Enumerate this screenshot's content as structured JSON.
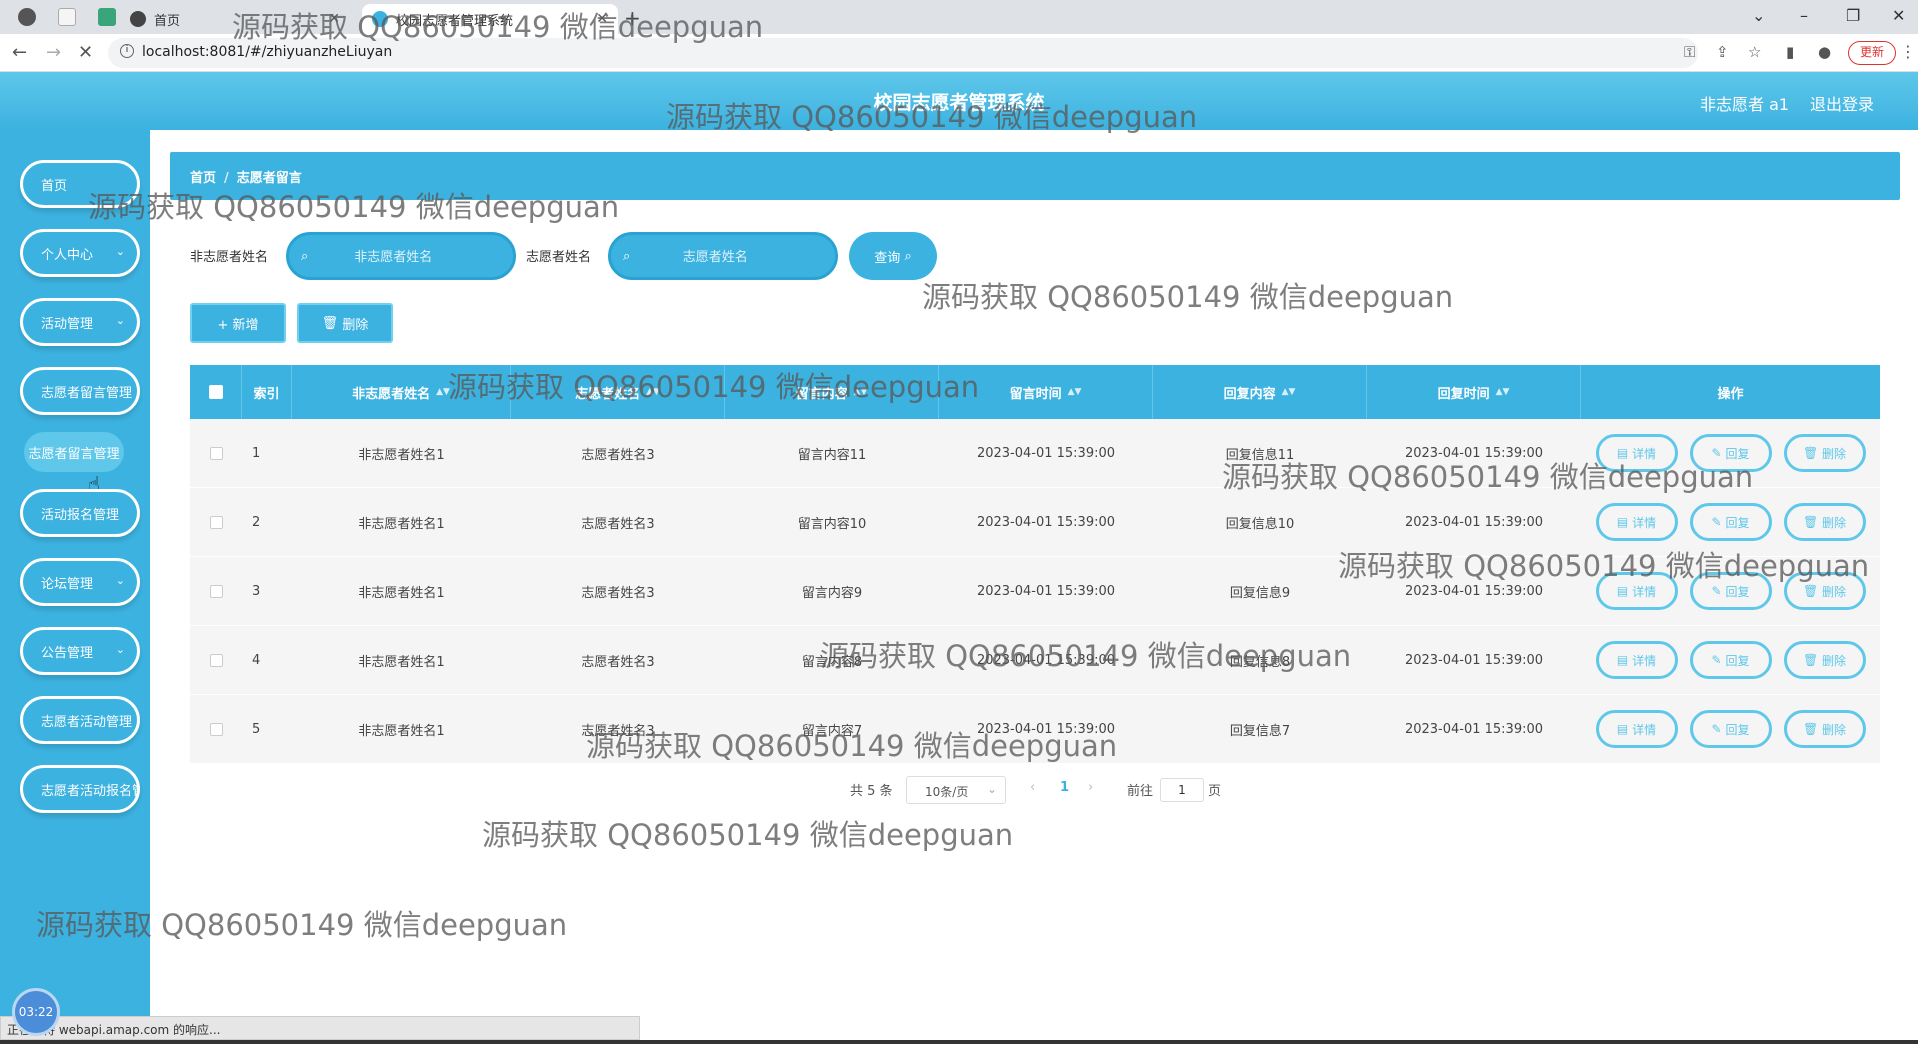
{
  "browser": {
    "tabs": [
      {
        "label": "首页"
      },
      {
        "label": "校园志愿者管理系统"
      }
    ],
    "url": "localhost:8081/#/zhiyuanzheLiuyan",
    "update_label": "更新",
    "status_text": "正在等待 webapi.amap.com 的响应..."
  },
  "header": {
    "title": "校园志愿者管理系统",
    "user": "非志愿者 a1",
    "logout": "退出登录"
  },
  "sidebar": {
    "items": [
      {
        "label": "首页"
      },
      {
        "label": "个人中心"
      },
      {
        "label": "活动管理"
      },
      {
        "label": "志愿者留言管理"
      },
      {
        "label": "活动报名管理"
      },
      {
        "label": "论坛管理"
      },
      {
        "label": "公告管理"
      },
      {
        "label": "志愿者活动管理"
      },
      {
        "label": "志愿者活动报名管理"
      }
    ],
    "active_sub": "志愿者留言管理"
  },
  "breadcrumb": {
    "home": "首页",
    "sep": "/",
    "current": "志愿者留言"
  },
  "filters": {
    "f1_label": "非志愿者姓名",
    "f1_placeholder": "非志愿者姓名",
    "f2_label": "志愿者姓名",
    "f2_placeholder": "志愿者姓名",
    "query_label": "查询"
  },
  "actions": {
    "add": "+ 新增",
    "delete": "删除"
  },
  "table": {
    "headers": [
      "索引",
      "非志愿者姓名",
      "志愿者姓名",
      "留言内容",
      "留言时间",
      "回复内容",
      "回复时间",
      "操作"
    ],
    "rows": [
      {
        "idx": "1",
        "c1": "非志愿者姓名1",
        "c2": "志愿者姓名3",
        "c3": "留言内容11",
        "c4": "2023-04-01 15:39:00",
        "c5": "回复信息11",
        "c6": "2023-04-01 15:39:00"
      },
      {
        "idx": "2",
        "c1": "非志愿者姓名1",
        "c2": "志愿者姓名3",
        "c3": "留言内容10",
        "c4": "2023-04-01 15:39:00",
        "c5": "回复信息10",
        "c6": "2023-04-01 15:39:00"
      },
      {
        "idx": "3",
        "c1": "非志愿者姓名1",
        "c2": "志愿者姓名3",
        "c3": "留言内容9",
        "c4": "2023-04-01 15:39:00",
        "c5": "回复信息9",
        "c6": "2023-04-01 15:39:00"
      },
      {
        "idx": "4",
        "c1": "非志愿者姓名1",
        "c2": "志愿者姓名3",
        "c3": "留言内容8",
        "c4": "2023-04-01 15:39:00",
        "c5": "回复信息8",
        "c6": "2023-04-01 15:39:00"
      },
      {
        "idx": "5",
        "c1": "非志愿者姓名1",
        "c2": "志愿者姓名3",
        "c3": "留言内容7",
        "c4": "2023-04-01 15:39:00",
        "c5": "回复信息7",
        "c6": "2023-04-01 15:39:00"
      }
    ],
    "op_detail": "详情",
    "op_reply": "回复",
    "op_delete": "删除"
  },
  "pagination": {
    "total": "共 5 条",
    "page_size": "10条/页",
    "current": "1",
    "goto_label": "前往",
    "goto_value": "1",
    "page_unit": "页"
  },
  "clock": "03:22",
  "watermark": "源码获取 QQ86050149 微信deepguan",
  "colors": {
    "accent": "#3cb2e0",
    "accent_light": "#5ec7ea"
  }
}
